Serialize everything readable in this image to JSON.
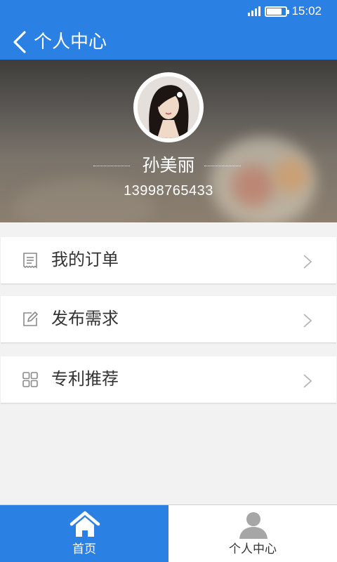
{
  "status_bar": {
    "time": "15:02",
    "icons": [
      "signal-icon",
      "battery-icon"
    ]
  },
  "header": {
    "title": "个人中心",
    "back_icon": "chevron-left-icon"
  },
  "profile": {
    "name": "孙美丽",
    "phone": "13998765433"
  },
  "menu": [
    {
      "label": "我的订单",
      "icon": "receipt-icon"
    },
    {
      "label": "发布需求",
      "icon": "edit-icon"
    },
    {
      "label": "专利推荐",
      "icon": "grid-icon"
    }
  ],
  "tabbar": {
    "tabs": [
      {
        "label": "首页",
        "icon": "home-icon",
        "active": true
      },
      {
        "label": "个人中心",
        "icon": "user-icon",
        "active": false
      }
    ]
  },
  "colors": {
    "primary": "#2a81e3",
    "background": "#f2f2f2"
  }
}
